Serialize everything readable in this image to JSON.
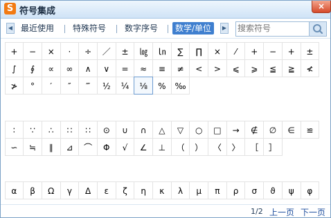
{
  "window": {
    "title": "符号集成",
    "logo_letter": "S",
    "close_label": "×"
  },
  "tabs": {
    "left_arrow": "◀",
    "right_arrow": "▶",
    "items": [
      "最近使用",
      "特殊符号",
      "数字序号",
      "数学/单位"
    ],
    "active_index": 3
  },
  "search": {
    "placeholder": "搜索符号"
  },
  "symbols": {
    "group1": [
      "+",
      "−",
      "×",
      "·",
      "÷",
      "／",
      "±",
      "㏒",
      "㏑",
      "∑",
      "∏",
      "×",
      "⁄",
      "+",
      "−",
      "+",
      "±",
      "∫",
      "∮",
      "∝",
      "∞",
      "∧",
      "∨",
      "=",
      "≈",
      "≡",
      "≠",
      "<",
      ">",
      "⩽",
      "⩾",
      "≦",
      "≧",
      "≮",
      "≯",
      "°",
      "′",
      "″",
      "‴",
      "½",
      "¼",
      "⅛",
      "%",
      "‰"
    ],
    "group2": [
      "∶",
      "∵",
      "∴",
      "∷",
      "∷",
      "⊙",
      "∪",
      "∩",
      "△",
      "▽",
      "○",
      "□",
      "→",
      "∉",
      "∅",
      "∈",
      "≌",
      "∽",
      "≒",
      "∥",
      "⊿",
      "⌒",
      "Φ",
      "√",
      "∠",
      "⊥",
      "（",
      "）",
      "〈",
      "〉",
      "［",
      "］"
    ],
    "group3": [
      "α",
      "β",
      "Ω",
      "γ",
      "Δ",
      "ε",
      "ζ",
      "η",
      "κ",
      "λ",
      "μ",
      "π",
      "ρ",
      "σ",
      "ϑ",
      "ψ",
      "φ"
    ],
    "selected": {
      "group": "group1",
      "index": 41
    }
  },
  "footer": {
    "page_info": "1/2",
    "prev_label": "上一页",
    "next_label": "下一页"
  },
  "colors": {
    "accent": "#3f7fcf",
    "logo": "#f27a12",
    "close": "#d64a2a"
  }
}
